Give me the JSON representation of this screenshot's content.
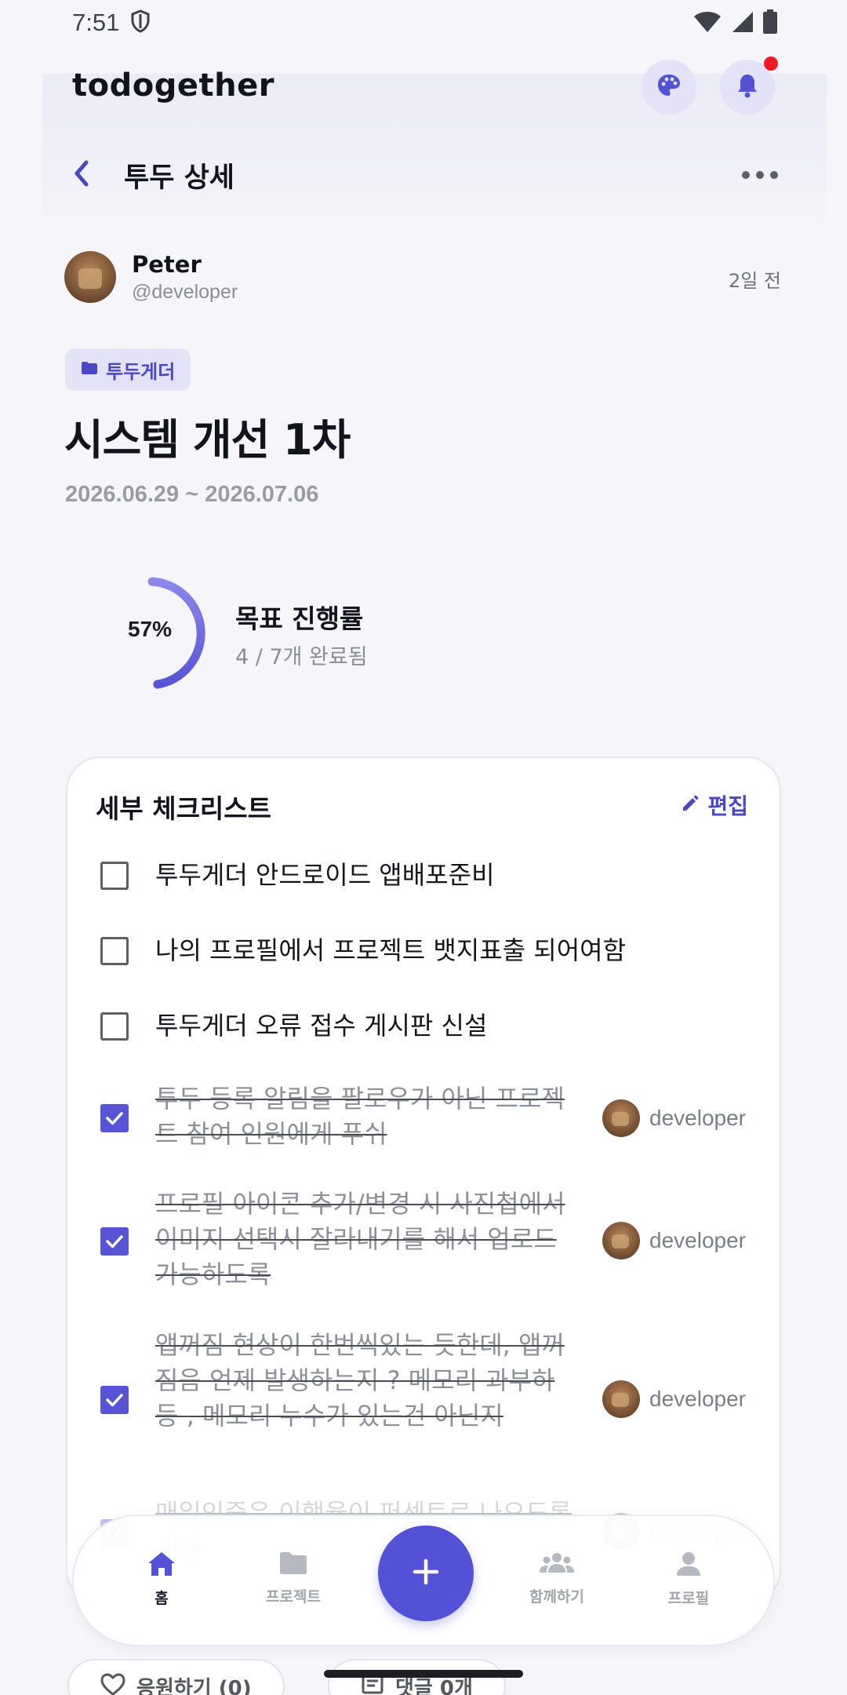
{
  "status_bar": {
    "time": "7:51"
  },
  "header": {
    "app_title": "todogether"
  },
  "nav": {
    "title": "투두 상세"
  },
  "author": {
    "name": "Peter",
    "handle": "@developer",
    "posted": "2일 전"
  },
  "todo": {
    "project": "투두게더",
    "title": "시스템 개선 1차",
    "dates": "2026.06.29 ~ 2026.07.06"
  },
  "progress": {
    "value": 0.57,
    "percent_label": "57%",
    "label": "목표 진행률",
    "summary": "4 / 7개 완료됨"
  },
  "checklist": {
    "title": "세부 체크리스트",
    "edit_label": "편집",
    "items": [
      {
        "text": "투두게더 안드로이드 앱배포준비",
        "done": false
      },
      {
        "text": "나의 프로필에서 프로젝트 뱃지표출 되어여함",
        "done": false
      },
      {
        "text": "투두게더 오류 접수 게시판 신설",
        "done": false
      },
      {
        "text": "투두 등록 알림을 팔로우가 아닌 프로젝트 참여 인원에게 푸쉬",
        "done": true,
        "assignee": "developer"
      },
      {
        "text": "프로필 아이콘 추가/변경 시 사진첩에서 이미지 선택시 잘라내기를 해서 업로드 가능하도록",
        "done": true,
        "assignee": "developer"
      },
      {
        "text": "앱꺼짐 현상이 한번씩있는 듯한데, 앱꺼짐음 언제 발생하는지 ? 메모리 과부하 등 , 메모리 누수가 있는건 아닌지",
        "done": true,
        "assignee": "developer"
      },
      {
        "text": "매일인증은 이행율이 퍼센트로 나오도록 개선",
        "done": true,
        "assignee": "developer"
      }
    ]
  },
  "bottom_nav": {
    "home": "홈",
    "projects": "프로젝트",
    "together": "함께하기",
    "profile": "프로필"
  },
  "actions": {
    "cheer": "응원하기 (0)",
    "comments": "댓글 0개"
  },
  "colors": {
    "accent": "#5352d6",
    "chip_bg": "#e4e2f7",
    "notification_dot": "#ee1c25"
  }
}
